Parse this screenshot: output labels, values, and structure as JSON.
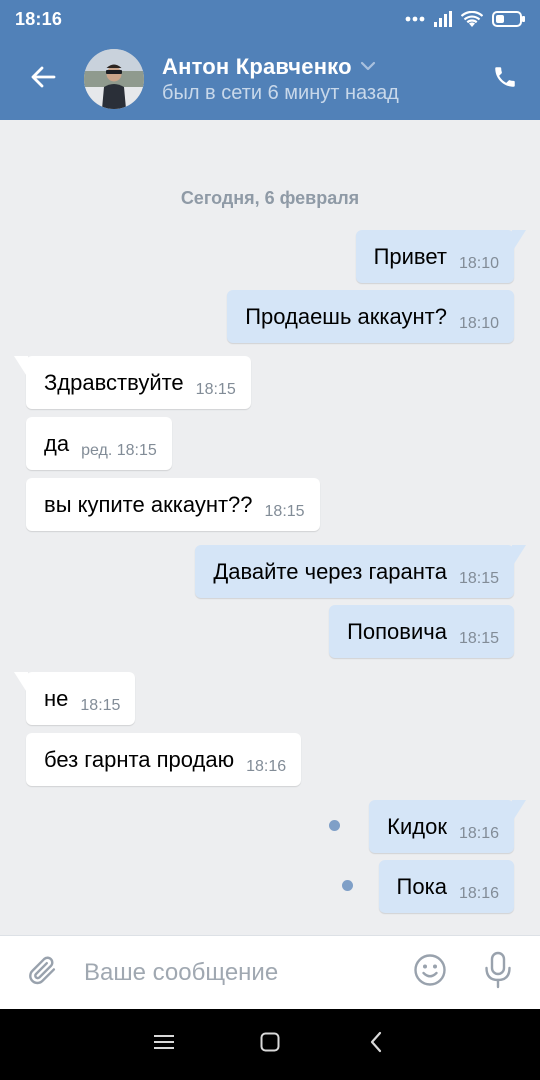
{
  "status_bar": {
    "time": "18:16"
  },
  "header": {
    "contact_name": "Антон Кравченко",
    "last_seen": "был в сети 6 минут назад"
  },
  "date_divider": "Сегодня, 6 февраля",
  "messages": [
    {
      "direction": "out",
      "text": "Привет",
      "time": "18:10"
    },
    {
      "direction": "out",
      "text": "Продаешь аккаунт?",
      "time": "18:10"
    },
    {
      "direction": "in",
      "text": "Здравствуйте",
      "time": "18:15"
    },
    {
      "direction": "in",
      "text": "да",
      "time": "ред. 18:15"
    },
    {
      "direction": "in",
      "text": "вы купите аккаунт??",
      "time": "18:15"
    },
    {
      "direction": "out",
      "text": "Давайте через гаранта",
      "time": "18:15"
    },
    {
      "direction": "out",
      "text": "Поповича",
      "time": "18:15"
    },
    {
      "direction": "in",
      "text": "не",
      "time": "18:15"
    },
    {
      "direction": "in",
      "text": "без гарнта продаю",
      "time": "18:16"
    },
    {
      "direction": "out",
      "text": "Кидок",
      "time": "18:16",
      "unread": true
    },
    {
      "direction": "out",
      "text": "Пока",
      "time": "18:16",
      "unread": true
    }
  ],
  "composer": {
    "placeholder": "Ваше сообщение"
  },
  "icons": {
    "back": "arrow-left-icon",
    "call": "phone-icon",
    "attach": "paperclip-icon",
    "emoji": "smiley-icon",
    "mic": "microphone-icon",
    "nav_menu": "menu-icon",
    "nav_home": "home-square-icon",
    "nav_back": "chevron-left-icon"
  },
  "colors": {
    "header_bg": "#5181b8",
    "chat_bg": "#edeef0",
    "outgoing_bubble": "#d5e5f7",
    "incoming_bubble": "#ffffff",
    "unread_dot": "#7f9fc7"
  }
}
